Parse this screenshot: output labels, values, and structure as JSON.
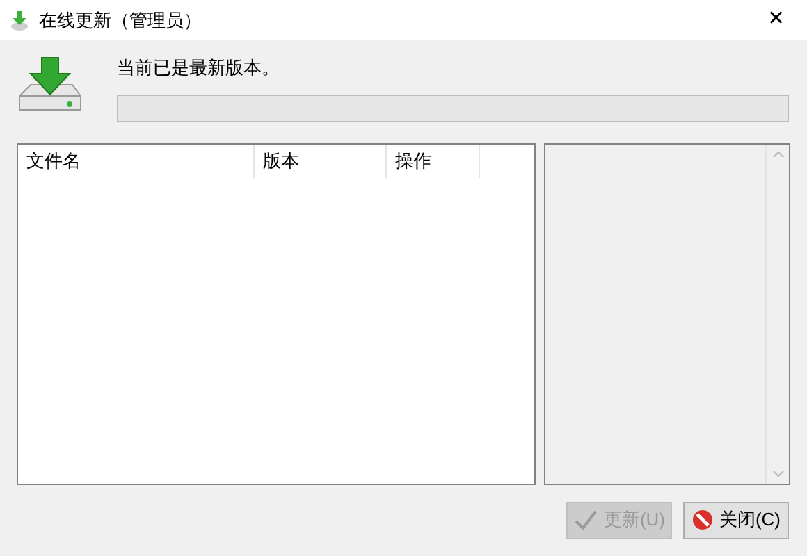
{
  "window": {
    "title": "在线更新（管理员）",
    "close": "✕"
  },
  "status": {
    "message": "当前已是最新版本。",
    "level": 0
  },
  "table": {
    "columns": [
      "文件名",
      "版本",
      "操作"
    ]
  },
  "buttons": [
    {
      "label": "更新(U)",
      "kind": "check",
      "disabled": true
    },
    {
      "label": "关闭(C)",
      "kind": "stop",
      "disabled": false
    }
  ]
}
